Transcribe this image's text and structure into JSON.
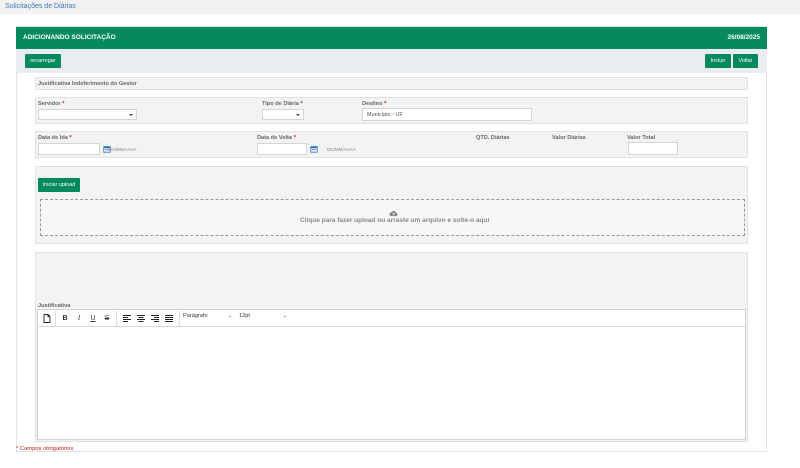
{
  "breadcrumb": "Solicitações de Diárias",
  "header": {
    "title": "ADICIONANDO SOLICITAÇÃO",
    "date": "26/08/2025"
  },
  "toolbar": {
    "reload_label": "recarregar",
    "include_label": "Incluir",
    "back_label": "Voltar"
  },
  "section_justification_title": "Justificativa Indeferimento do Gestor",
  "fields": {
    "servidor": {
      "label": "Servidor",
      "value": ""
    },
    "tipo_diaria": {
      "label": "Tipo de Diária",
      "value": ""
    },
    "destino": {
      "label": "Destino",
      "value": "Município - UF"
    },
    "data_ida": {
      "label": "Data de Ida",
      "placeholder": "DD/MM/AAAA"
    },
    "data_volta": {
      "label": "Data de Volta",
      "placeholder": "DD/MM/AAAA"
    },
    "qtd_diarias": {
      "label": "QTD. Diárias"
    },
    "valor_diarias": {
      "label": "Valor Diárias"
    },
    "valor_total": {
      "label": "Valor Total",
      "value": ""
    }
  },
  "required_mark": "*",
  "upload": {
    "button_label": "Iniciar upload",
    "drop_message": "Clique para fazer upload ou arraste um arquivo e solte-o aqui"
  },
  "justificativa": {
    "label": "Justificativa",
    "paragraph_select": "Parágrafo",
    "size_select": "12pt",
    "content": ""
  },
  "footer_note": "* Campos obrigatórios",
  "colors": {
    "primary": "#058a5c",
    "link": "#3a78b8",
    "required": "#cc0000"
  },
  "icons": [
    "new-document-icon",
    "bold-icon",
    "italic-icon",
    "underline-icon",
    "strikethrough-icon",
    "align-left-icon",
    "align-center-icon",
    "align-right-icon",
    "align-justify-icon",
    "calendar-icon",
    "cloud-upload-icon"
  ]
}
